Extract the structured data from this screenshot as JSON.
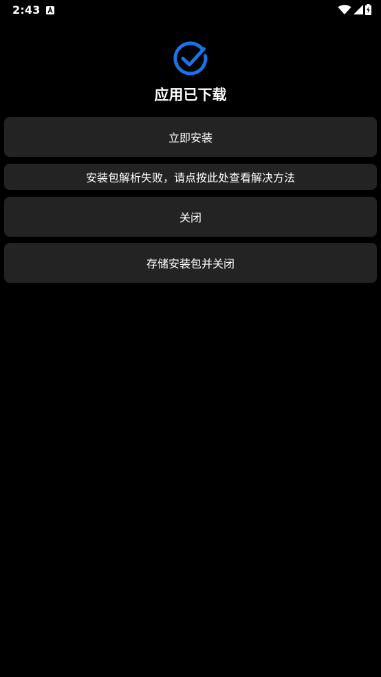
{
  "status_bar": {
    "time": "2:43",
    "notification_icon": "a-notification-icon",
    "wifi_icon": "wifi-icon",
    "signal_icon": "signal-icon",
    "battery_icon": "battery-charging-icon"
  },
  "header": {
    "icon": "check-circle-icon",
    "accent_color": "#1a73e8",
    "title": "应用已下载"
  },
  "actions": {
    "install_label": "立即安装",
    "parse_failed_help_label": "安装包解析失败，请点按此处查看解决方法",
    "close_label": "关闭",
    "save_and_close_label": "存储安装包并关闭"
  }
}
